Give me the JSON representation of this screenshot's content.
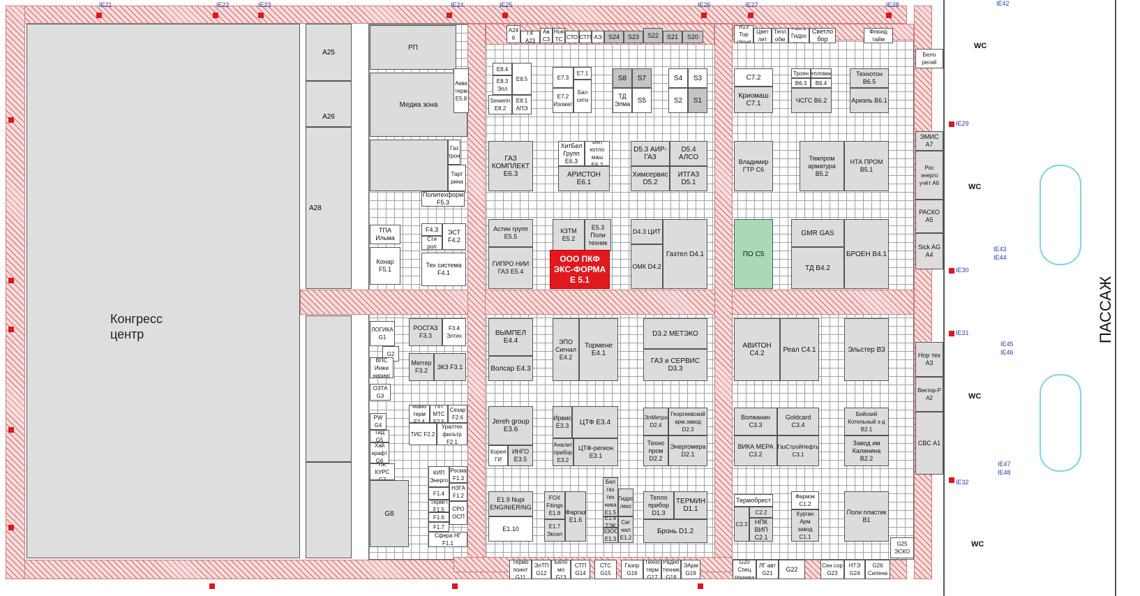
{
  "map": {
    "congress_center": "Конгресс центр",
    "passage": "ПАССАЖ",
    "highlight": {
      "line1": "ООО ПКФ",
      "line2": "ЭКС-ФОРМА",
      "code": "Е 5.1"
    },
    "halls": [
      "А25",
      "А26",
      "А28"
    ],
    "wc_label": "WC",
    "signs": [
      "IE21",
      "IE22",
      "IE23",
      "IE24",
      "IE25",
      "IE26",
      "IE27",
      "IE28",
      "IE29",
      "IE30",
      "IE31",
      "IE32",
      "IE42",
      "IE43",
      "IE44",
      "IE45",
      "IE46",
      "IE47",
      "IE48"
    ]
  },
  "booths": [
    {
      "t": "РП"
    },
    {
      "t": "Медиа зона"
    },
    {
      "t": "Аква терм Е5.8"
    },
    {
      "t": "Газ трон"
    },
    {
      "t": "Тарт рина"
    },
    {
      "t": "Политехформ F5.3"
    },
    {
      "t": "ТПА Ильма"
    },
    {
      "t": "Конар F5.1"
    },
    {
      "t": "F4.3"
    },
    {
      "t": "Сти рол"
    },
    {
      "t": "ЭСТ F4.2"
    },
    {
      "t": "Тех система F4.1"
    },
    {
      "t": "Е8.4"
    },
    {
      "t": "Е8.5"
    },
    {
      "t": "Е8.3 Эпл"
    },
    {
      "t": "Sewerin Е8.2"
    },
    {
      "t": "Е8.1 АПЭ"
    },
    {
      "t": "Е7.3"
    },
    {
      "t": "Е7.1"
    },
    {
      "t": "Е7.2 Изомат"
    },
    {
      "t": "Бал сити"
    },
    {
      "t": "S8"
    },
    {
      "t": "S7"
    },
    {
      "t": "S4"
    },
    {
      "t": "S3"
    },
    {
      "t": "ТД Элма"
    },
    {
      "t": "S5"
    },
    {
      "t": "S2"
    },
    {
      "t": "S1"
    },
    {
      "t": "С7.2"
    },
    {
      "t": "Криомаш С7.1"
    },
    {
      "t": "Троян"
    },
    {
      "t": "Тепломаш"
    },
    {
      "t": "В6.3"
    },
    {
      "t": "В6.4"
    },
    {
      "t": "Технотон В6.5"
    },
    {
      "t": "ЧСГС В6.2"
    },
    {
      "t": "Ариэль В6.1"
    },
    {
      "t": "ГАЗ КОМПЛЕКТ Е6.3"
    },
    {
      "t": "ХитБел Групп Е6.3"
    },
    {
      "t": "Бел котло маш Е6.2"
    },
    {
      "t": "АРИСТОН Е6.1"
    },
    {
      "t": "D5.3 АИР-ГАЗ"
    },
    {
      "t": "D5.4 АЛСО"
    },
    {
      "t": "Химсервис D5.2"
    },
    {
      "t": "ИТГАЗ D5.1"
    },
    {
      "t": "Владимир ГТР С6"
    },
    {
      "t": "Тяжпром арматура В5.2"
    },
    {
      "t": "НТА ПРОМ В5.1"
    },
    {
      "t": "Астин групп Е5.5"
    },
    {
      "t": "КЗТМ Е5.2"
    },
    {
      "t": "Е5.3 Поли техник"
    },
    {
      "t": "ГИПРО НИИ ГАЗ Е5.4"
    },
    {
      "t": "D4.3 ЦИТ"
    },
    {
      "t": "ОМК D4.2"
    },
    {
      "t": "Газтел D4.1"
    },
    {
      "t": "ПО С5"
    },
    {
      "t": "GMR GAS"
    },
    {
      "t": "ТД В4.2"
    },
    {
      "t": "БРОЕН В4.1"
    },
    {
      "t": "ЛОГИКА G1"
    },
    {
      "t": "РОСГАЗ F3.3"
    },
    {
      "t": "F3.4 Элтех"
    },
    {
      "t": "G2"
    },
    {
      "t": "ВПС Инжи ниринг"
    },
    {
      "t": "Меггер F3.2"
    },
    {
      "t": "ЗКЗ F3.1"
    },
    {
      "t": "ВЫМПЕЛ Е4.4"
    },
    {
      "t": "ЭПО Сигнал Е4.2"
    },
    {
      "t": "Тормене Е4.1"
    },
    {
      "t": "Волсар Е4.3"
    },
    {
      "t": "D3.2 МЕТЭКО"
    },
    {
      "t": "ГАЗ и СЕРВИС D3.3"
    },
    {
      "t": "АВИТОН С4.2"
    },
    {
      "t": "Реал С4.1"
    },
    {
      "t": "Эльстер В3"
    },
    {
      "t": "ОЗТА G3"
    },
    {
      "t": "PW G4"
    },
    {
      "t": "ТиД G5"
    },
    {
      "t": "Хай крафт G6"
    },
    {
      "t": "ПК КУРС G7"
    },
    {
      "t": "Мано терм F2.4"
    },
    {
      "t": "ПП МТС F2.5"
    },
    {
      "t": "Сезар F2.6"
    },
    {
      "t": "ТИС F2.2"
    },
    {
      "t": "Уралтех фильтр F2.1"
    },
    {
      "t": "Jereh group Е3.6"
    },
    {
      "t": "Ирвис Е3.3"
    },
    {
      "t": "ЦТФ Е3.4"
    },
    {
      "t": "Корея ГИ"
    },
    {
      "t": "ИНГО Е3.5"
    },
    {
      "t": "Аналит прибор Е3.2"
    },
    {
      "t": "ЦТФ-регион Е3.1"
    },
    {
      "t": "ЭлМетро D2.4"
    },
    {
      "t": "Георгиевский арм.завод D2.3"
    },
    {
      "t": "Техно пром D2.2"
    },
    {
      "t": "Энергомера D2.1"
    },
    {
      "t": "Волжанин С3.3"
    },
    {
      "t": "Goldcard С3.4"
    },
    {
      "t": "ВИКА МЕРА С3.2"
    },
    {
      "t": "ГазСтройНефть С3.1"
    },
    {
      "t": "Бийский Котельный з-д В2.1"
    },
    {
      "t": "Завод им Калинина В2.2"
    },
    {
      "t": "G8"
    },
    {
      "t": "КИП Энерго"
    },
    {
      "t": "Росма F1.3"
    },
    {
      "t": "F1.4"
    },
    {
      "t": "НЗГА F1.2"
    },
    {
      "t": "ТермП F1.5"
    },
    {
      "t": "СРО ОСП"
    },
    {
      "t": "F1.6"
    },
    {
      "t": "F1.7"
    },
    {
      "t": "Сфера НГ F1.1"
    },
    {
      "t": "Е1.9 Nupi ENGINIERING"
    },
    {
      "t": "Е1.10"
    },
    {
      "t": "FOX Fitings Е1.8"
    },
    {
      "t": "Е1.7 Эксел"
    },
    {
      "t": "Фаргаз Е1.6"
    },
    {
      "t": "Бел газ тех ника Е1.5"
    },
    {
      "t": "Е1.4 ТЭК"
    },
    {
      "t": "ЗЭОС Е1.3"
    },
    {
      "t": "Гидро лекс"
    },
    {
      "t": "Сиг нал Е1.2"
    },
    {
      "t": "Тепло прибор D1.3"
    },
    {
      "t": "ТЕРМИН D1.1"
    },
    {
      "t": "Бронь D1.2"
    },
    {
      "t": "Термобрест"
    },
    {
      "t": "С2.3"
    },
    {
      "t": "С2.2"
    },
    {
      "t": "НПК ВИП С2.1"
    },
    {
      "t": "Фармэк С1.2"
    },
    {
      "t": "Курган Арм завод С1.1"
    },
    {
      "t": "Поли пластик В1"
    },
    {
      "t": "Термо поинт G11"
    },
    {
      "t": "ЭлТП G12"
    },
    {
      "t": "Бело мо G13"
    },
    {
      "t": "СТП G14"
    },
    {
      "t": "СТС G15"
    },
    {
      "t": "Газпр G16"
    },
    {
      "t": "Техно терм G17"
    },
    {
      "t": "Радио техник G18"
    },
    {
      "t": "ЭАрм G19"
    },
    {
      "t": "G20 Спец техника"
    },
    {
      "t": "ЛГ авт G21"
    },
    {
      "t": "G22"
    },
    {
      "t": "Сен сор G23"
    },
    {
      "t": "НТЭ G24"
    },
    {
      "t": "G26 Силена"
    },
    {
      "t": "G25 ЭСКО"
    },
    {
      "t": "А24 6"
    },
    {
      "t": "ГК А23"
    },
    {
      "t": "Ав С3"
    },
    {
      "t": "Нов ТС"
    },
    {
      "t": "СТО"
    },
    {
      "t": "СТП"
    },
    {
      "t": "АЭ"
    },
    {
      "t": "S24"
    },
    {
      "t": "S23"
    },
    {
      "t": "S22"
    },
    {
      "t": "S21"
    },
    {
      "t": "S20"
    },
    {
      "t": "А13 Тор climat"
    },
    {
      "t": "Цвет лит"
    },
    {
      "t": "Тепл обм"
    },
    {
      "t": "А10.1 Гидро леко"
    },
    {
      "t": "Светло бор"
    },
    {
      "t": "Флюид тайм"
    },
    {
      "t": "Бело регий"
    },
    {
      "t": "ЭМИС А7"
    },
    {
      "t": "Рос энерго учёт А6"
    },
    {
      "t": "РАСКО А5"
    },
    {
      "t": "Sick AG А4"
    },
    {
      "t": "Нор тех А3"
    },
    {
      "t": "Вектор-Р А2"
    },
    {
      "t": "СВС А1"
    }
  ]
}
